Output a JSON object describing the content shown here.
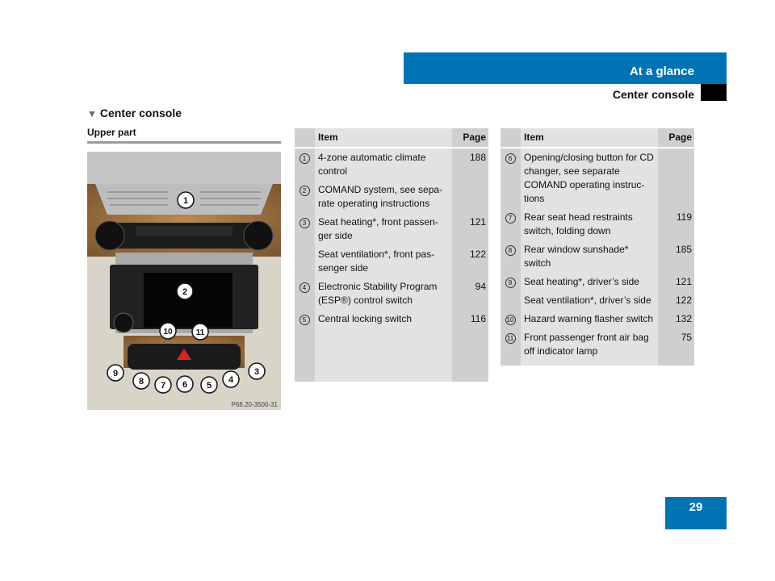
{
  "header": {
    "chapter": "At a glance",
    "section": "Center console"
  },
  "heading": "Center console",
  "subheading": "Upper part",
  "image": {
    "code": "P68.20-3500-31",
    "callouts": [
      "1",
      "2",
      "3",
      "4",
      "5",
      "6",
      "7",
      "8",
      "9",
      "10",
      "11"
    ]
  },
  "table_headers": {
    "item": "Item",
    "page": "Page"
  },
  "table1": [
    {
      "num": "1",
      "item": "4-zone automatic climate control",
      "page": "188"
    },
    {
      "num": "2",
      "item": "COMAND system, see sepa-rate operating instructions",
      "page": ""
    },
    {
      "num": "3",
      "item": "Seat heating*, front passen-ger side",
      "page": "121"
    },
    {
      "num": "",
      "item": "Seat ventilation*, front pas-senger side",
      "page": "122"
    },
    {
      "num": "4",
      "item": "Electronic Stability Program (ESP®) control switch",
      "page": "94"
    },
    {
      "num": "5",
      "item": "Central locking switch",
      "page": "116"
    }
  ],
  "table2": [
    {
      "num": "6",
      "item": "Opening/closing button for CD changer, see separate COMAND operating instruc-tions",
      "page": ""
    },
    {
      "num": "7",
      "item": "Rear seat head restraints switch, folding down",
      "page": "119"
    },
    {
      "num": "8",
      "item": "Rear window sunshade* switch",
      "page": "185"
    },
    {
      "num": "9",
      "item": "Seat heating*, driver’s side",
      "page": "121"
    },
    {
      "num": "",
      "item": "Seat ventilation*, driver’s side",
      "page": "122"
    },
    {
      "num": "10",
      "item": "Hazard warning flasher switch",
      "page": "132"
    },
    {
      "num": "11",
      "item": "Front passenger front air bag off indicator lamp",
      "page": "75"
    }
  ],
  "page_number": "29",
  "colors": {
    "accent": "#0073b4",
    "table_bg": "#e2e2e2",
    "table_col": "#cfcfcf"
  }
}
